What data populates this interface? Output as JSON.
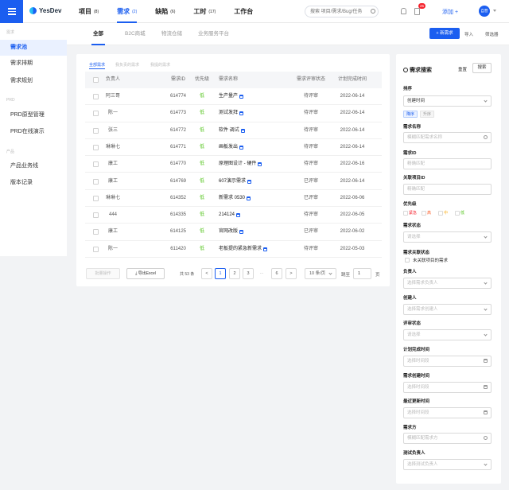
{
  "app": {
    "logo": "YesDev"
  },
  "nav": {
    "items": [
      {
        "label": "项目",
        "count": "(8)"
      },
      {
        "label": "需求",
        "count": "(2)"
      },
      {
        "label": "缺陷",
        "count": "(6)"
      },
      {
        "label": "工时",
        "count": "(17)"
      },
      {
        "label": "工作台",
        "count": ""
      }
    ],
    "search_placeholder": "搜索 项目/需求/Bug/任务",
    "badge": "25",
    "add_label": "添加 +",
    "avatar": "自营"
  },
  "sidebar": {
    "groups": [
      "需求",
      "PRD",
      "产品"
    ],
    "items": [
      "需求池",
      "需求排期",
      "需求规划",
      "PRD原型管理",
      "PRD在线演示",
      "产品业务线",
      "版本记录"
    ]
  },
  "subtabs": [
    "全部",
    "B2C商城",
    "物流仓储",
    "业务服务平台"
  ],
  "toolbar": {
    "new_label": "+ 新需求",
    "import_label": "导入",
    "filter_label": "筛选器"
  },
  "views": [
    "全部需求",
    "我负责的需求",
    "我提的需求"
  ],
  "table": {
    "headers": [
      "负责人",
      "需求ID",
      "优先级",
      "需求名称",
      "需求评审状态",
      "计划完成时间"
    ],
    "rows": [
      {
        "owner": "阿三哥",
        "id": "614774",
        "priority": "低",
        "name": "生产量产",
        "status": "待评审",
        "date": "2022-06-14"
      },
      {
        "owner": "陈一",
        "id": "614773",
        "priority": "低",
        "name": "测试发拜",
        "status": "待评审",
        "date": "2022-06-14"
      },
      {
        "owner": "张三",
        "id": "614772",
        "priority": "低",
        "name": "软件 调试",
        "status": "待评审",
        "date": "2022-06-14"
      },
      {
        "owner": "琳琳七",
        "id": "614771",
        "priority": "低",
        "name": "画板发出",
        "status": "待评审",
        "date": "2022-06-14"
      },
      {
        "owner": "康工",
        "id": "614770",
        "priority": "低",
        "name": "原理图设计 - 硬件",
        "status": "待评审",
        "date": "2022-06-16"
      },
      {
        "owner": "康工",
        "id": "614769",
        "priority": "低",
        "name": "607演示需求",
        "status": "已评审",
        "date": "2022-06-14"
      },
      {
        "owner": "琳琳七",
        "id": "614352",
        "priority": "低",
        "name": "新需求 0530",
        "status": "已评审",
        "date": "2022-06-06"
      },
      {
        "owner": "444",
        "id": "614335",
        "priority": "低",
        "name": "214124",
        "status": "待评审",
        "date": "2022-06-05"
      },
      {
        "owner": "康工",
        "id": "614125",
        "priority": "低",
        "name": "官网改版",
        "status": "已评审",
        "date": "2022-06-02"
      },
      {
        "owner": "陈一",
        "id": "611420",
        "priority": "低",
        "name": "老板提的紧急新需求",
        "status": "待评审",
        "date": "2022-05-03"
      }
    ]
  },
  "footer": {
    "batch_label": "批量操作",
    "export_label": "导出Excel",
    "total": "共 53 条",
    "pages": [
      "<",
      "1",
      "2",
      "3",
      "...",
      "6",
      ">"
    ],
    "page_size": "10 条/页",
    "jump_label": "跳至",
    "jump_value": "1",
    "page_unit": "页"
  },
  "panel": {
    "title": "需求搜索",
    "reset": "重置",
    "search": "搜索",
    "fields": [
      {
        "label": "排序",
        "value": "创建时间",
        "kind": "select",
        "has_value": true
      },
      {
        "label": "需求名称",
        "value": "模糊匹配需求名称",
        "kind": "search"
      },
      {
        "label": "需求ID",
        "value": "精确匹配",
        "kind": "text"
      },
      {
        "label": "关联项目ID",
        "value": "精确匹配",
        "kind": "text"
      },
      {
        "label": "需求状态",
        "value": "请选择",
        "kind": "select"
      },
      {
        "label": "负责人",
        "value": "选择需求负责人",
        "kind": "select"
      },
      {
        "label": "创建人",
        "value": "选择需求创建人",
        "kind": "select"
      },
      {
        "label": "评审状态",
        "value": "请选择",
        "kind": "select"
      },
      {
        "label": "计划完成时间",
        "value": "选择时间段",
        "kind": "date"
      },
      {
        "label": "需求创建时间",
        "value": "选择时间段",
        "kind": "date"
      },
      {
        "label": "最近更新时间",
        "value": "选择时间段",
        "kind": "date"
      },
      {
        "label": "需求方",
        "value": "模糊匹配需求方",
        "kind": "search"
      },
      {
        "label": "测试负责人",
        "value": "选择测试负责人",
        "kind": "select"
      }
    ],
    "sort_asc": "降序",
    "sort_desc": "升序",
    "priority_label": "优先级",
    "priorities": [
      {
        "label": "紧急",
        "color": "#f5222d"
      },
      {
        "label": "高",
        "color": "#fa541c"
      },
      {
        "label": "中",
        "color": "#faad14"
      },
      {
        "label": "低",
        "color": "#52c41a"
      }
    ],
    "link_label": "需求关联状态",
    "link_option": "未关联项目的需求"
  }
}
